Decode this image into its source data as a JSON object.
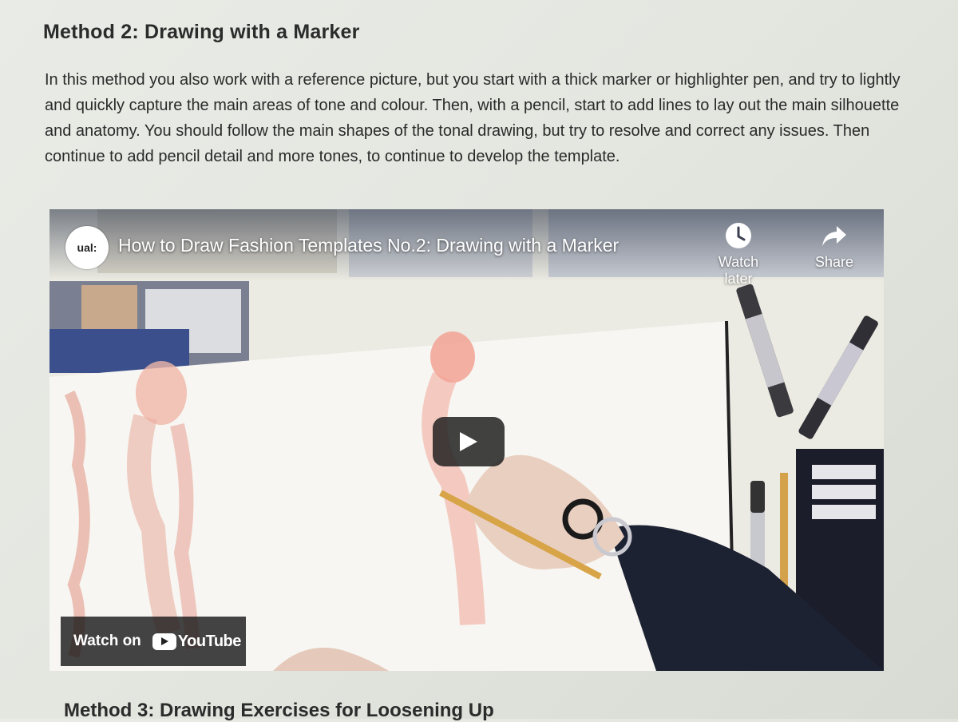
{
  "article": {
    "method2_heading": "Method 2: Drawing with a Marker",
    "method2_paragraph": "In this method you also work with a reference picture, but you start with a thick marker or highlighter pen, and try to lightly and quickly capture the main areas of tone and colour. Then, with a pencil, start to add lines to lay out the main silhouette and anatomy. You should follow the main shapes of the tonal drawing, but try to resolve and correct any issues. Then continue to add pencil detail and more tones, to continue to develop the template.",
    "method3_heading": "Method 3: Drawing Exercises for Loosening Up"
  },
  "video": {
    "channel_logo_text": "ual:",
    "title": "How to Draw Fashion Templates No.2: Drawing with a Marker",
    "watch_later_label": "Watch later",
    "share_label": "Share",
    "watch_on_label": "Watch on",
    "youtube_label": "YouTube",
    "icons": {
      "watch_later": "clock-icon",
      "share": "share-arrow-icon",
      "play": "play-icon",
      "youtube": "youtube-logo-icon"
    },
    "colors": {
      "play_button_bg": "#212121",
      "overlay_text": "#ffffff"
    }
  }
}
